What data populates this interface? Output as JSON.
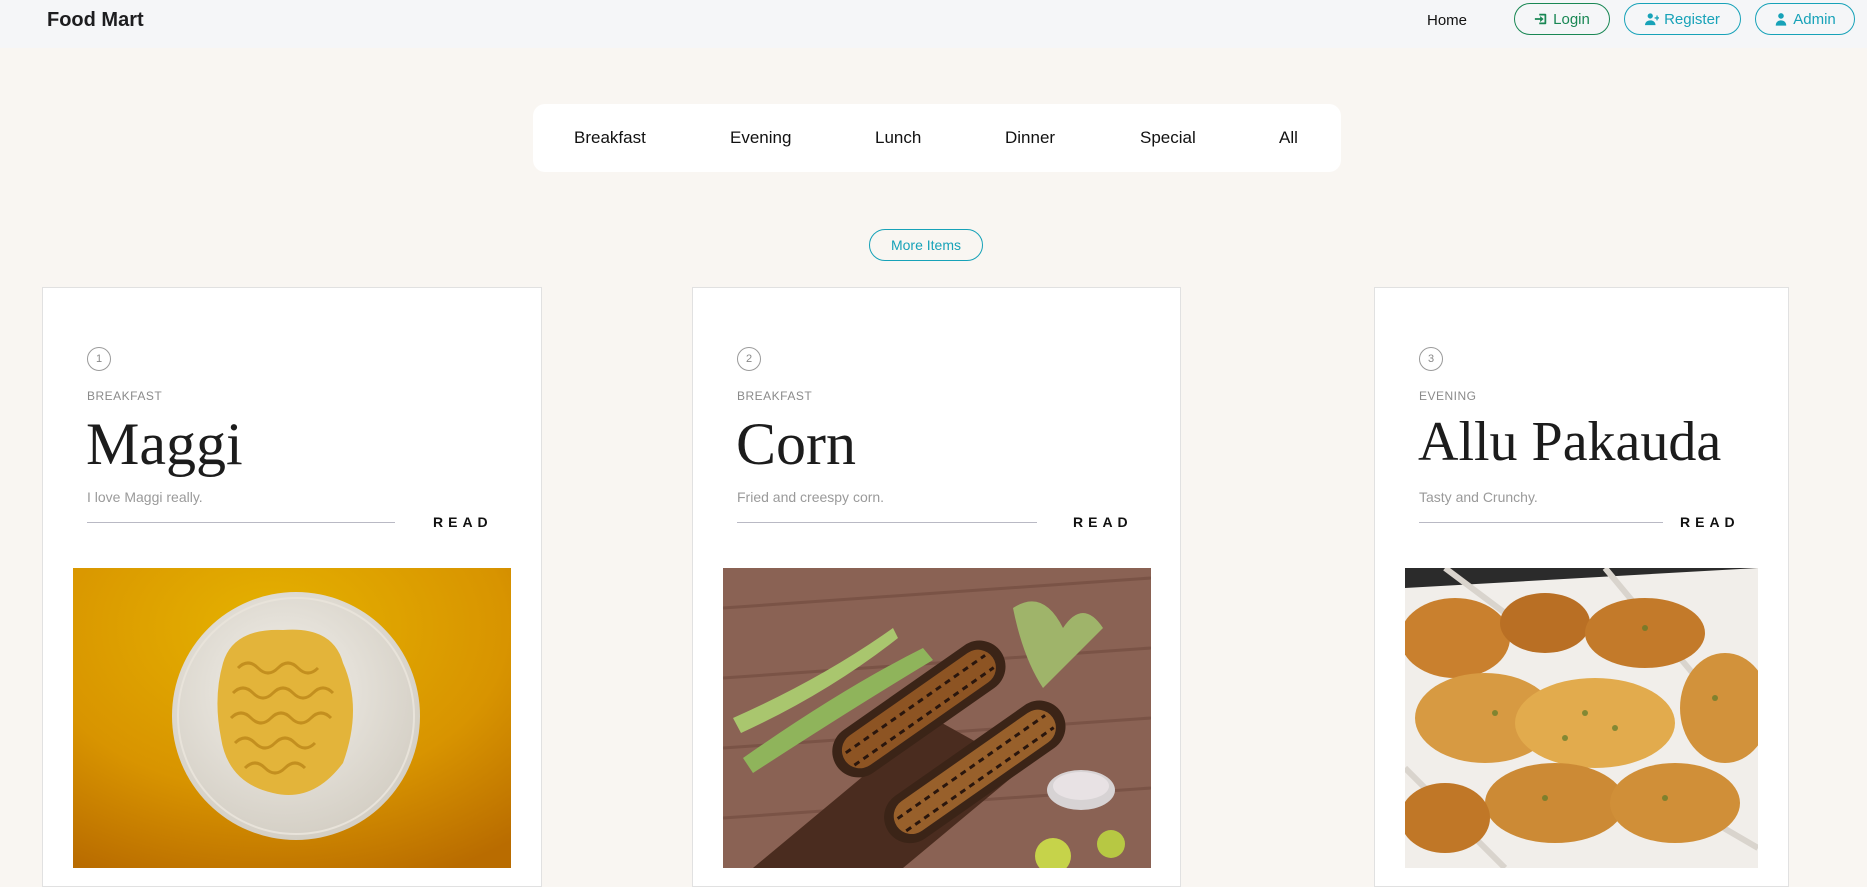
{
  "navbar": {
    "brand": "Food Mart",
    "home": "Home",
    "login": "Login",
    "register": "Register",
    "admin": "Admin"
  },
  "categories": [
    "Breakfast",
    "Evening",
    "Lunch",
    "Dinner",
    "Special",
    "All"
  ],
  "more_items": "More Items",
  "cards": [
    {
      "number": "1",
      "category": "BREAKFAST",
      "title": "Maggi",
      "description": "I love Maggi really.",
      "read": "READ"
    },
    {
      "number": "2",
      "category": "BREAKFAST",
      "title": "Corn",
      "description": "Fried and creespy corn.",
      "read": "READ"
    },
    {
      "number": "3",
      "category": "EVENING",
      "title": "Allu Pakauda",
      "description": "Tasty and Crunchy.",
      "read": "READ"
    }
  ],
  "colors": {
    "accent": "#17a2b8",
    "login": "#198754",
    "page_bg": "#f9f6f2"
  }
}
